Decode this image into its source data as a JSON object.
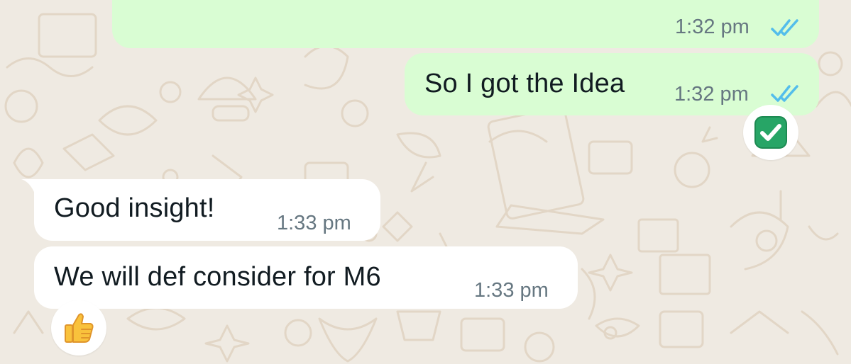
{
  "messages": [
    {
      "direction": "outgoing",
      "text": "",
      "time": "1:32 pm",
      "status": "read"
    },
    {
      "direction": "outgoing",
      "text": "So I got the Idea",
      "time": "1:32 pm",
      "status": "read",
      "reaction": "check-mark-button-emoji"
    },
    {
      "direction": "incoming",
      "text": "Good insight!",
      "time": "1:33 pm"
    },
    {
      "direction": "incoming",
      "text": "We will def consider for M6",
      "time": "1:33 pm",
      "reaction": "thumbs-up-emoji"
    }
  ],
  "colors": {
    "wallpaper": "#efeae2",
    "outgoing_bubble": "#d9fdd3",
    "incoming_bubble": "#ffffff",
    "read_ticks": "#53bdeb",
    "meta_text": "#667781"
  }
}
